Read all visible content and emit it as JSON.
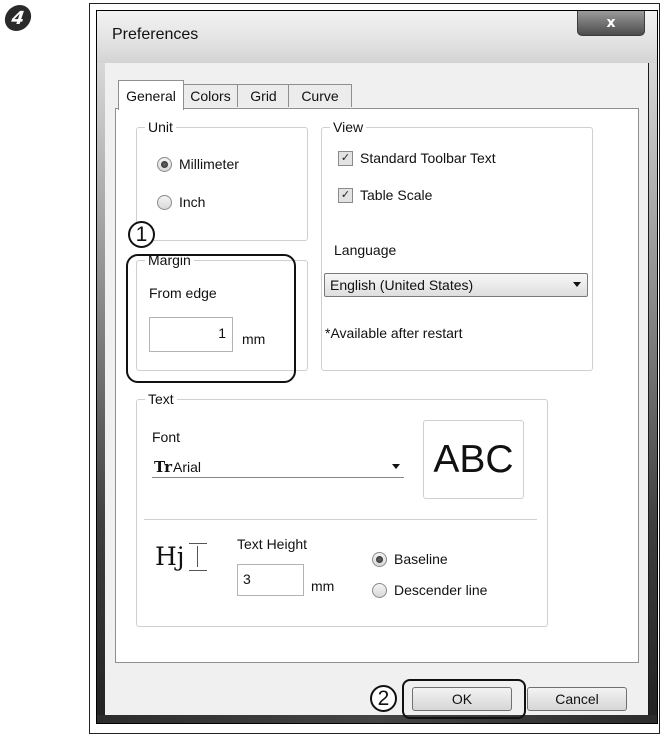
{
  "step_number": "4",
  "window": {
    "title": "Preferences",
    "close_glyph": "x"
  },
  "tabs": [
    {
      "label": "General",
      "active": true
    },
    {
      "label": "Colors",
      "active": false
    },
    {
      "label": "Grid",
      "active": false
    },
    {
      "label": "Curve",
      "active": false
    }
  ],
  "unit": {
    "label": "Unit",
    "options": [
      {
        "label": "Millimeter",
        "selected": true
      },
      {
        "label": "Inch",
        "selected": false
      }
    ]
  },
  "margin": {
    "label": "Margin",
    "from_edge_label": "From edge",
    "value": "1",
    "unit_label": "mm"
  },
  "view": {
    "label": "View",
    "standard_toolbar_text": {
      "label": "Standard Toolbar Text",
      "checked": true
    },
    "table_scale": {
      "label": "Table Scale",
      "checked": true
    },
    "language_label": "Language",
    "language_value": "English (United States)",
    "restart_note": "*Available after restart"
  },
  "text": {
    "label": "Text",
    "font_label": "Font",
    "font_icon": "Tr",
    "font_value": "Arial",
    "preview": "ABC",
    "height_icon": "Hj",
    "text_height_label": "Text Height",
    "text_height_value": "3",
    "text_height_unit": "mm",
    "options": [
      {
        "label": "Baseline",
        "selected": true
      },
      {
        "label": "Descender line",
        "selected": false
      }
    ]
  },
  "callouts": {
    "one": "1",
    "two": "2"
  },
  "buttons": {
    "ok": "OK",
    "cancel": "Cancel"
  }
}
